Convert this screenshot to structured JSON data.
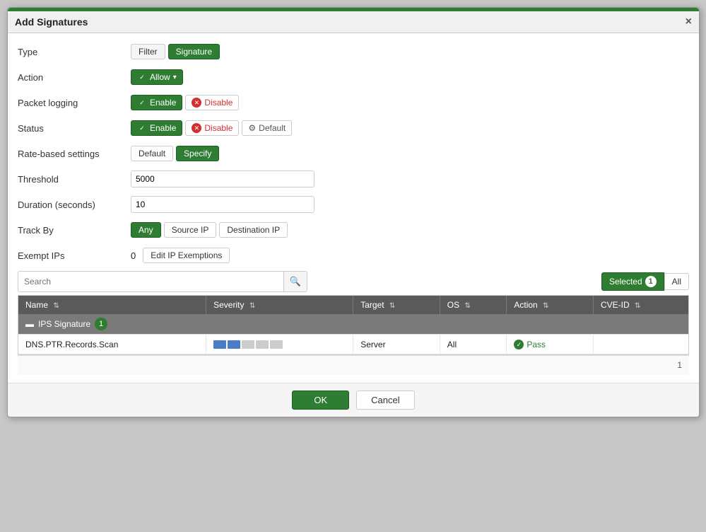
{
  "dialog": {
    "title": "Add Signatures",
    "close_label": "×"
  },
  "form": {
    "type_label": "Type",
    "type_filter": "Filter",
    "type_signature": "Signature",
    "action_label": "Action",
    "action_allow": "Allow",
    "action_dropdown": "▾",
    "packet_logging_label": "Packet logging",
    "packet_enable": "Enable",
    "packet_disable": "Disable",
    "status_label": "Status",
    "status_enable": "Enable",
    "status_disable": "Disable",
    "status_default": "Default",
    "rate_based_label": "Rate-based settings",
    "rate_default": "Default",
    "rate_specify": "Specify",
    "threshold_label": "Threshold",
    "threshold_value": "5000",
    "duration_label": "Duration (seconds)",
    "duration_value": "10",
    "track_by_label": "Track By",
    "track_any": "Any",
    "track_source": "Source IP",
    "track_dest": "Destination IP",
    "exempt_ips_label": "Exempt IPs",
    "exempt_count": "0",
    "exempt_edit": "Edit IP Exemptions"
  },
  "search": {
    "placeholder": "Search",
    "search_icon": "🔍"
  },
  "selected_btn": "Selected",
  "selected_count": "1",
  "all_btn": "All",
  "table": {
    "columns": [
      {
        "id": "name",
        "label": "Name"
      },
      {
        "id": "severity",
        "label": "Severity"
      },
      {
        "id": "target",
        "label": "Target"
      },
      {
        "id": "os",
        "label": "OS"
      },
      {
        "id": "action",
        "label": "Action"
      },
      {
        "id": "cve_id",
        "label": "CVE-ID"
      }
    ],
    "group": {
      "label": "IPS Signature",
      "count": "1",
      "collapse_icon": "▬"
    },
    "rows": [
      {
        "name": "DNS.PTR.Records.Scan",
        "severity_bars": [
          {
            "color": "#4a7cc7",
            "active": true
          },
          {
            "color": "#4a7cc7",
            "active": true
          },
          {
            "color": "#ccc",
            "active": false
          },
          {
            "color": "#ccc",
            "active": false
          },
          {
            "color": "#ccc",
            "active": false
          }
        ],
        "target": "Server",
        "os": "All",
        "action_icon": "✓",
        "action": "Pass",
        "cve_id": ""
      }
    ]
  },
  "footer": {
    "page_number": "1"
  },
  "buttons": {
    "ok": "OK",
    "cancel": "Cancel"
  }
}
